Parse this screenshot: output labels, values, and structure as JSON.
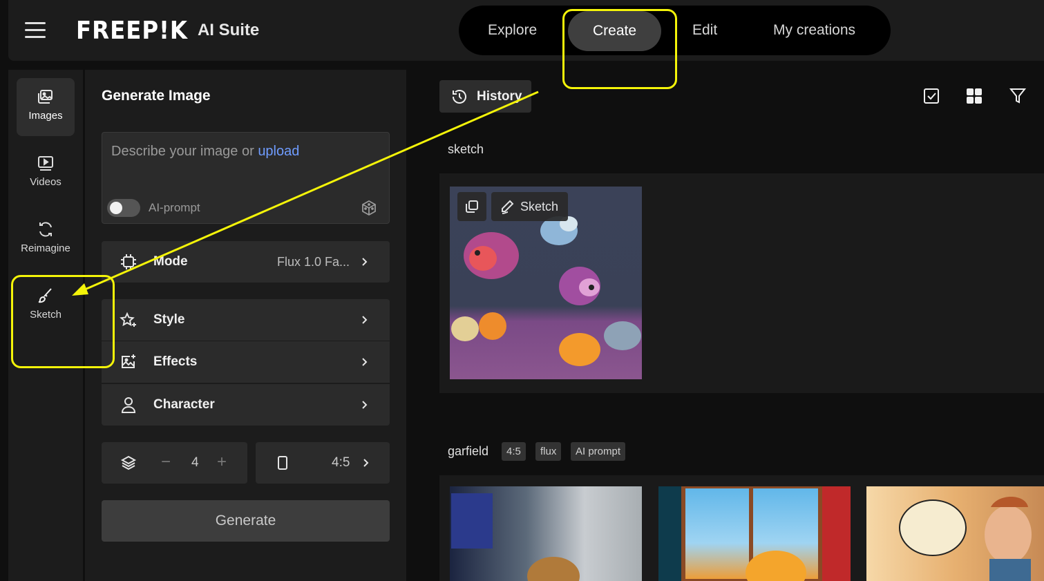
{
  "app": {
    "logo_text": "FREEP!K",
    "suite_text": "AI Suite"
  },
  "nav": {
    "tabs": [
      "Explore",
      "Create",
      "Edit",
      "My creations"
    ],
    "active_tab": "Create"
  },
  "rail": {
    "items": [
      {
        "label": "Images",
        "icon": "images-icon"
      },
      {
        "label": "Videos",
        "icon": "video-icon"
      },
      {
        "label": "Reimagine",
        "icon": "refresh-icon"
      },
      {
        "label": "Sketch",
        "icon": "brush-icon"
      }
    ],
    "active_item": "Images"
  },
  "panel": {
    "title": "Generate Image",
    "prompt_placeholder": "Describe your image or",
    "prompt_upload_link": "upload",
    "ai_prompt_label": "AI-prompt",
    "ai_prompt_on": false,
    "mode_label": "Mode",
    "mode_value": "Flux 1.0 Fa...",
    "style_label": "Style",
    "effects_label": "Effects",
    "character_label": "Character",
    "count_minus": "−",
    "count_value": "4",
    "count_plus": "+",
    "aspect_value": "4:5",
    "generate_label": "Generate"
  },
  "content": {
    "history_label": "History",
    "toolbar_icons": [
      "select-checkbox-icon",
      "grid-view-icon",
      "filter-icon"
    ],
    "groups": [
      {
        "label": "sketch",
        "tags": [],
        "items": [
          {
            "badge": "Sketch"
          }
        ]
      },
      {
        "label": "garfield",
        "tags": [
          "4:5",
          "flux",
          "AI prompt"
        ],
        "items": [
          {},
          {},
          {}
        ]
      }
    ]
  },
  "annotations": {
    "color": "#f4f409"
  }
}
